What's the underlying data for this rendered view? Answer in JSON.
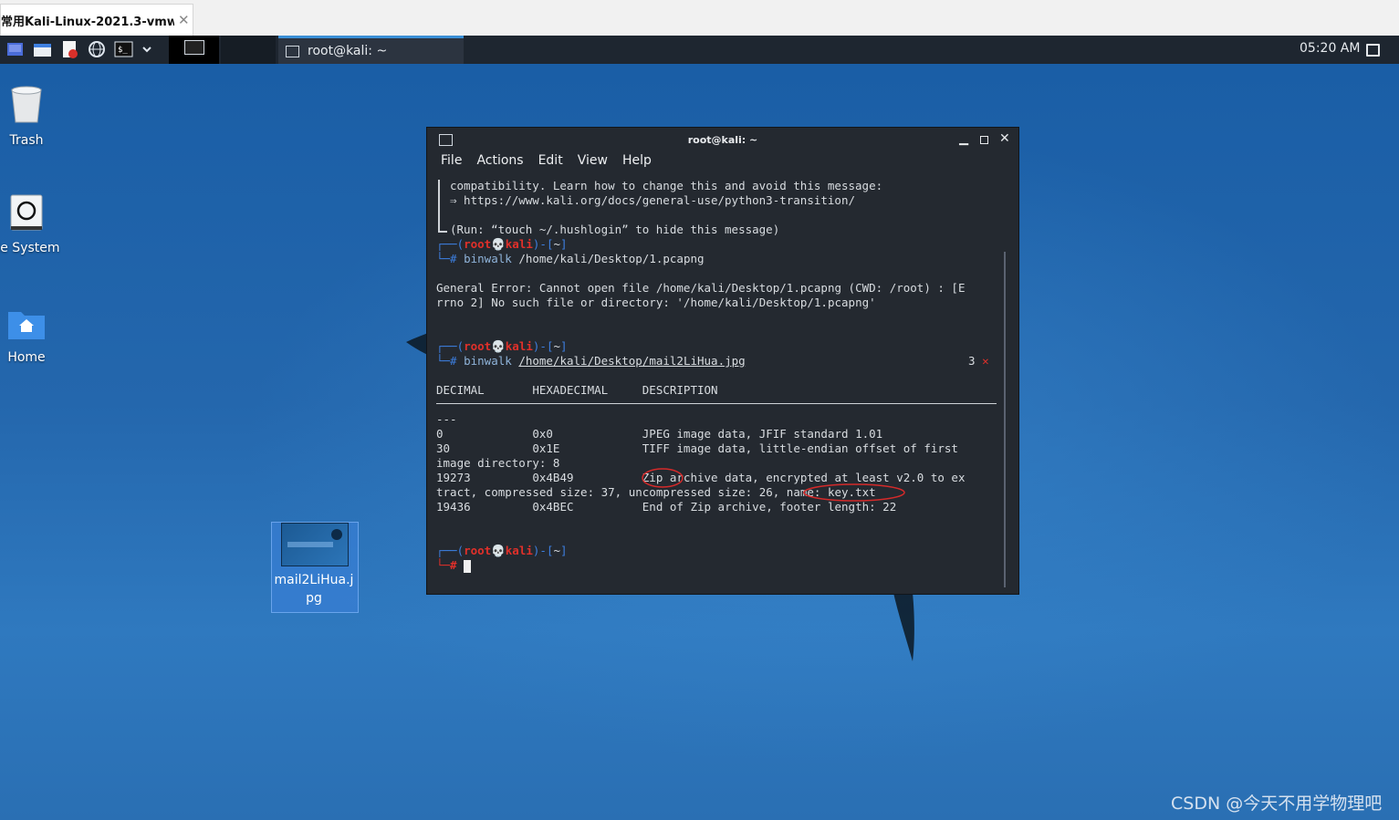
{
  "host": {
    "tab_label": "常用Kali-Linux-2021.3-vmw...",
    "tab_close": "✕"
  },
  "panel": {
    "task_label": "root@kali: ~",
    "clock": "05:20 AM",
    "launcher_icons": [
      "app-menu-icon",
      "file-manager-icon",
      "text-editor-icon",
      "web-browser-icon",
      "terminal-icon",
      "dropdown-chevron-icon"
    ]
  },
  "desktop": {
    "icons": [
      {
        "name": "trash",
        "label": "Trash"
      },
      {
        "name": "file-system",
        "label": "ile System"
      },
      {
        "name": "home",
        "label": "Home"
      }
    ],
    "file_label_line1": "mail2LiHua.j",
    "file_label_line2": "pg"
  },
  "terminal": {
    "title": "root@kali: ~",
    "menu": [
      "File",
      "Actions",
      "Edit",
      "View",
      "Help"
    ],
    "lines": {
      "l1": "compatibility. Learn how to change this and avoid this message:",
      "l2": "⇒ https://www.kali.org/docs/general-use/python3-transition/",
      "l3": "(Run: “touch ~/.hushlogin” to hide this message)",
      "prompt_a": "┌──(",
      "prompt_user": "root💀kali",
      "prompt_b": ")-[",
      "prompt_dir": "~",
      "prompt_c": "]",
      "prompt2": "└─#",
      "cmd1": "binwalk",
      "arg1": "/home/kali/Desktop/1.pcapng",
      "err1": "General Error: Cannot open file /home/kali/Desktop/1.pcapng (CWD: /root) : [E",
      "err2": "rrno 2] No such file or directory: '/home/kali/Desktop/1.pcapng'",
      "cmd2": "binwalk",
      "arg2": "/home/kali/Desktop/mail2LiHua.jpg",
      "exit_code": "3",
      "exit_mark": "✕",
      "hdr": "DECIMAL       HEXADECIMAL     DESCRIPTION",
      "dashes": "---",
      "r1": "0             0x0             JPEG image data, JFIF standard 1.01",
      "r2": "30            0x1E            TIFF image data, little-endian offset of first",
      "r3": "image directory: 8",
      "r4": "19273         0x4B49          Zip archive data, encrypted at least v2.0 to ex",
      "r5": "tract, compressed size: 37, uncompressed size: 26, name: key.txt",
      "r6": "19436         0x4BEC          End of Zip archive, footer length: 22"
    }
  },
  "watermark": "CSDN @今天不用学物理吧"
}
